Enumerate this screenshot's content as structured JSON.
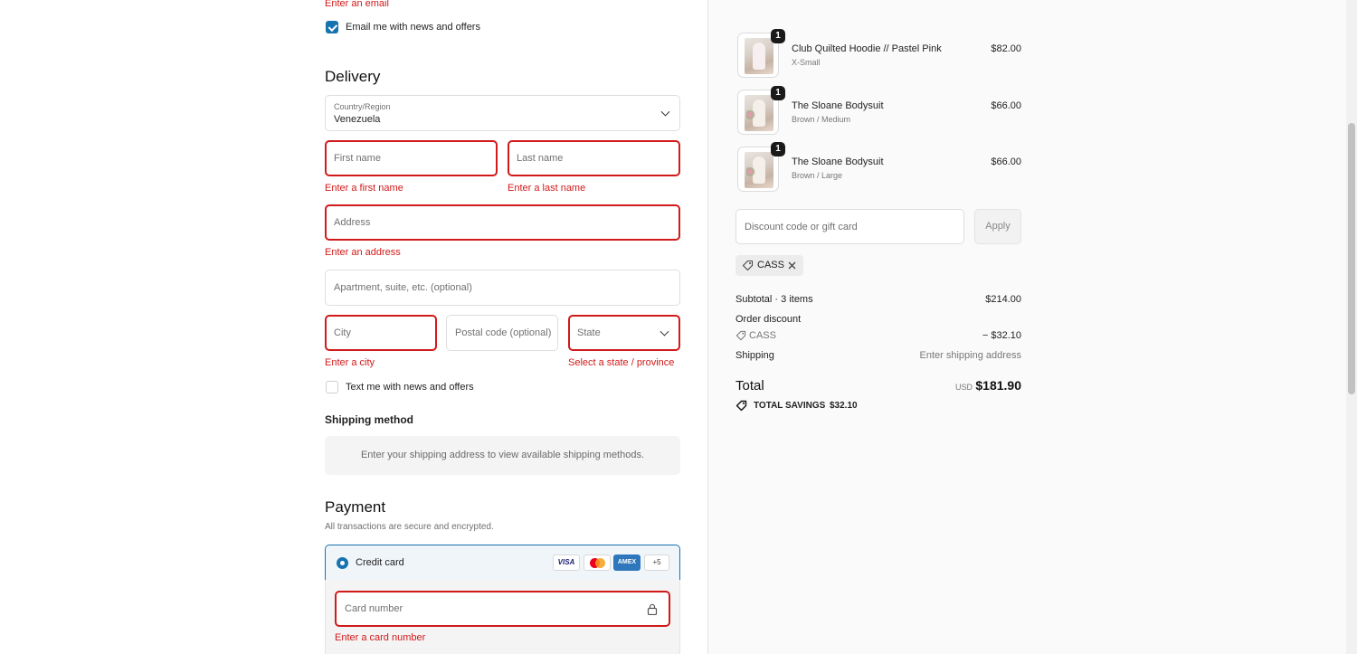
{
  "contact": {
    "email_error": "Enter an email",
    "email_news_label": "Email me with news and offers"
  },
  "delivery": {
    "title": "Delivery",
    "country_label": "Country/Region",
    "country_value": "Venezuela",
    "first_name_ph": "First name",
    "first_name_error": "Enter a first name",
    "last_name_ph": "Last name",
    "last_name_error": "Enter a last name",
    "address_ph": "Address",
    "address_error": "Enter an address",
    "apartment_ph": "Apartment, suite, etc. (optional)",
    "city_ph": "City",
    "city_error": "Enter a city",
    "postal_ph": "Postal code (optional)",
    "state_ph": "State",
    "state_error": "Select a state / province",
    "text_news_label": "Text me with news and offers"
  },
  "shipping": {
    "title": "Shipping method",
    "message": "Enter your shipping address to view available shipping methods."
  },
  "payment": {
    "title": "Payment",
    "subtitle": "All transactions are secure and encrypted.",
    "method_label": "Credit card",
    "cards": [
      "VISA",
      "",
      "AMEX",
      "+5"
    ],
    "card_number_ph": "Card number",
    "card_number_error": "Enter a card number"
  },
  "order": {
    "items": [
      {
        "name": "Club Quilted Hoodie // Pastel Pink",
        "variant": "X-Small",
        "price": "$82.00",
        "qty": "1"
      },
      {
        "name": "The Sloane Bodysuit",
        "variant": "Brown / Medium",
        "price": "$66.00",
        "qty": "1"
      },
      {
        "name": "The Sloane Bodysuit",
        "variant": "Brown / Large",
        "price": "$66.00",
        "qty": "1"
      }
    ],
    "discount_ph": "Discount code or gift card",
    "apply_label": "Apply",
    "applied_code": "CASS",
    "subtotal_label": "Subtotal · 3 items",
    "subtotal_value": "$214.00",
    "order_discount_label": "Order discount",
    "discount_code": "CASS",
    "discount_value": "− $32.10",
    "shipping_label": "Shipping",
    "shipping_value": "Enter shipping address",
    "total_label": "Total",
    "currency": "USD",
    "total_value": "$181.90",
    "savings_label": "TOTAL SAVINGS",
    "savings_value": "$32.10"
  },
  "colors": {
    "error": "#d11a1a",
    "accent": "#1773b0"
  }
}
